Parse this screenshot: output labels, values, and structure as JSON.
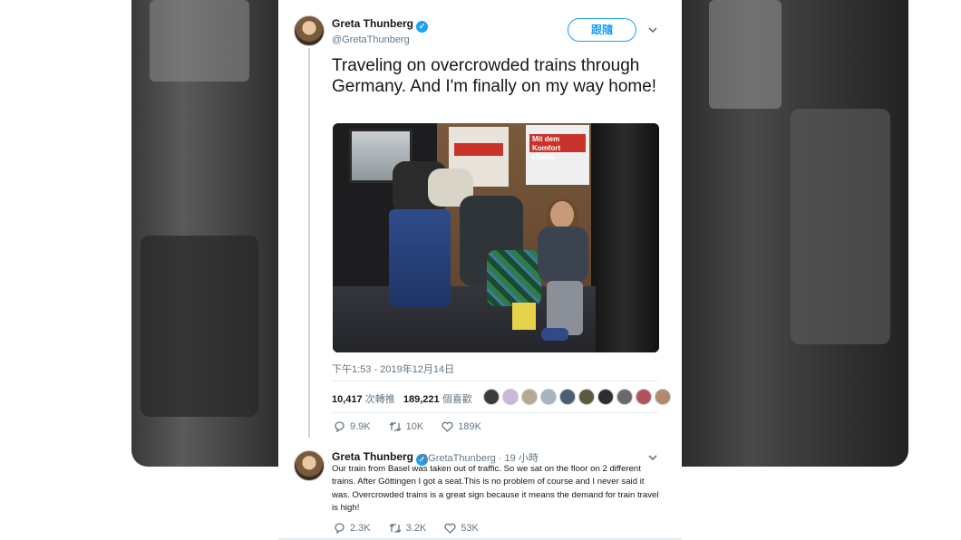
{
  "tweet": {
    "name": "Greta Thunberg",
    "handle": "@GretaThunberg",
    "follow_label": "跟隨",
    "text": "Traveling on overcrowded trains through Germany. And I'm finally on my way home!",
    "photo_text": "Mit dem Komfort Check",
    "timestamp": "下午1:53 - 2019年12月14日",
    "retweets": "10,417",
    "retweets_label": "次轉推",
    "likes": "189,221",
    "likes_label": "個喜歡",
    "actions": {
      "replies": "9.9K",
      "retweets": "10K",
      "likes": "189K"
    }
  },
  "reply": {
    "name": "Greta Thunberg",
    "meta": "@GretaThunberg · 19 小時",
    "text": "Our train from Basel was taken out of traffic. So we sat on the floor on 2 different trains. After Göttingen I got a seat.This is no problem of course and I never said it was. Overcrowded trains is a great sign because it means the demand for train travel is high!",
    "actions": {
      "replies": "2.3K",
      "retweets": "3.2K",
      "likes": "53K"
    }
  },
  "colors": {
    "accent": "#1da1f2",
    "text": "#14171a",
    "muted": "#657786"
  }
}
